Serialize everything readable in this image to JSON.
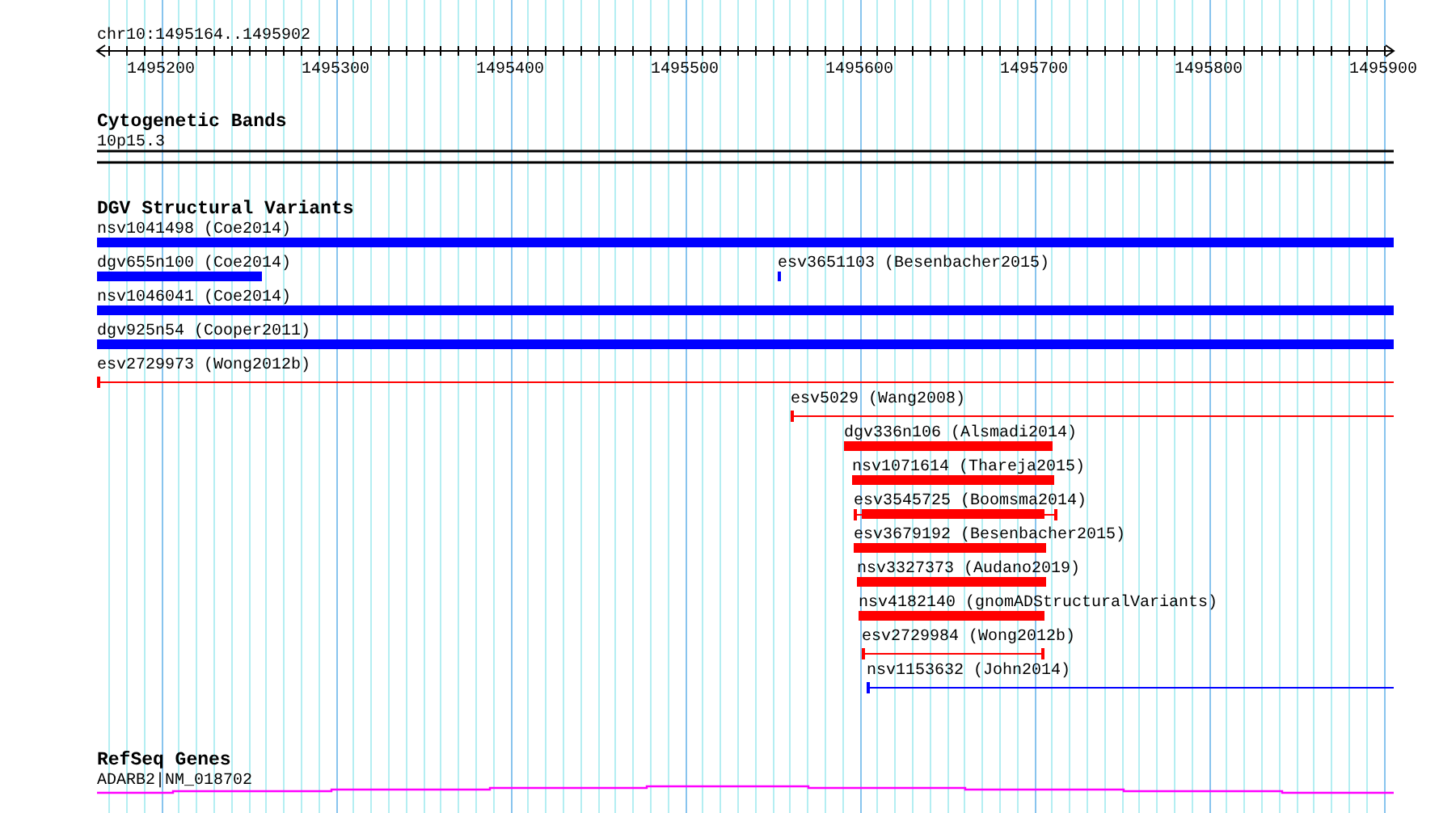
{
  "ruler": {
    "location": "chr10:1495164..1495902",
    "ticks": [
      "1495200",
      "1495300",
      "1495400",
      "1495500",
      "1495600",
      "1495700",
      "1495800",
      "1495900"
    ]
  },
  "tracks": [
    {
      "kind": "cytoband",
      "title": "Cytogenetic Bands",
      "features": [
        {
          "label": "10p15.3"
        }
      ]
    },
    {
      "kind": "variants",
      "title": "DGV Structural Variants",
      "features": [
        {
          "label": "nsv1041498 (Coe2014)",
          "kind": "bar",
          "color": "#0000ff"
        },
        {
          "label": "dgv655n100 (Coe2014)",
          "kind": "bar",
          "color": "#0000ff"
        },
        {
          "label": "esv3651103 (Besenbacher2015)",
          "kind": "bar",
          "color": "#0000ff"
        },
        {
          "label": "nsv1046041 (Coe2014)",
          "kind": "bar",
          "color": "#0000ff"
        },
        {
          "label": "dgv925n54 (Cooper2011)",
          "kind": "bar",
          "color": "#0000ff"
        },
        {
          "label": "esv2729973 (Wong2012b)",
          "kind": "line",
          "color": "#ff0000"
        },
        {
          "label": "esv5029 (Wang2008)",
          "kind": "line",
          "color": "#ff0000"
        },
        {
          "label": "dgv336n106 (Alsmadi2014)",
          "kind": "bar",
          "color": "#ff0000"
        },
        {
          "label": "nsv1071614 (Thareja2015)",
          "kind": "bar",
          "color": "#ff0000"
        },
        {
          "label": "esv3545725 (Boomsma2014)",
          "kind": "capped-bar",
          "color": "#ff0000"
        },
        {
          "label": "esv3679192 (Besenbacher2015)",
          "kind": "bar",
          "color": "#ff0000"
        },
        {
          "label": "nsv3327373 (Audano2019)",
          "kind": "bar",
          "color": "#ff0000"
        },
        {
          "label": "nsv4182140 (gnomADStructuralVariants)",
          "kind": "bar",
          "color": "#ff0000"
        },
        {
          "label": "esv2729984 (Wong2012b)",
          "kind": "line",
          "color": "#ff0000"
        },
        {
          "label": "nsv1153632 (John2014)",
          "kind": "line",
          "color": "#0000ff"
        }
      ]
    },
    {
      "kind": "gene",
      "title": "RefSeq Genes",
      "features": [
        {
          "label": "ADARB2|NM_018702"
        }
      ]
    }
  ]
}
